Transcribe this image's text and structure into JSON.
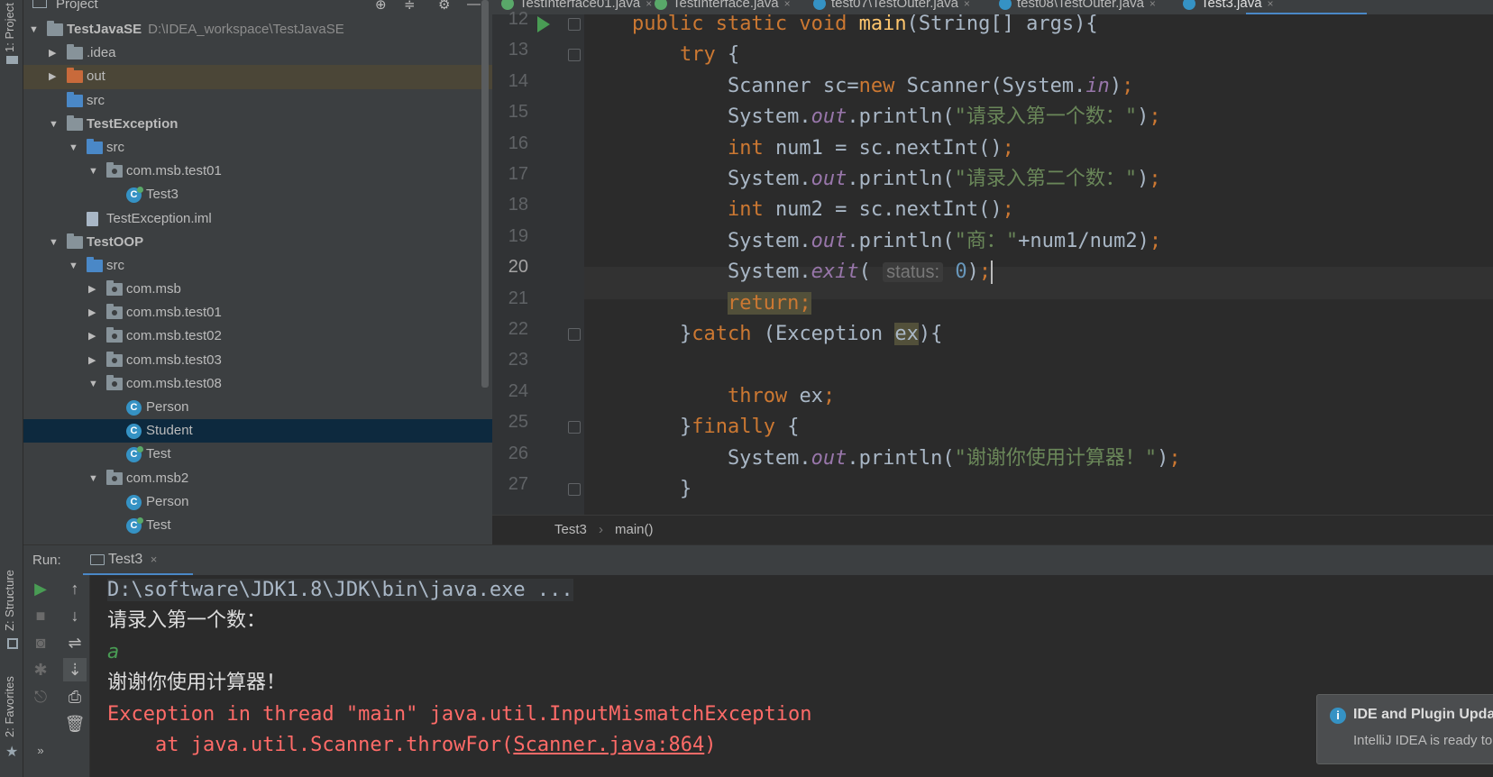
{
  "left_strip": {
    "project_label": "1: Project",
    "structure_label": "Z: Structure",
    "favorites_label": "2: Favorites"
  },
  "project_panel": {
    "title": "Project",
    "tree": [
      {
        "label": "TestJavaSE",
        "path": "D:\\IDEA_workspace\\TestJavaSE",
        "indent": 0,
        "arrow": "▼",
        "icon": "folder",
        "bold": true
      },
      {
        "label": ".idea",
        "indent": 1,
        "arrow": "▶",
        "icon": "folder"
      },
      {
        "label": "out",
        "indent": 1,
        "arrow": "▶",
        "icon": "folder-orange",
        "highlight": true
      },
      {
        "label": "src",
        "indent": 1,
        "arrow": "",
        "icon": "folder-blue"
      },
      {
        "label": "TestException",
        "indent": 1,
        "arrow": "▼",
        "icon": "folder",
        "bold": true
      },
      {
        "label": "src",
        "indent": 2,
        "arrow": "▼",
        "icon": "folder-blue"
      },
      {
        "label": "com.msb.test01",
        "indent": 3,
        "arrow": "▼",
        "icon": "package"
      },
      {
        "label": "Test3",
        "indent": 4,
        "arrow": "",
        "icon": "class-run"
      },
      {
        "label": "TestException.iml",
        "indent": 2,
        "arrow": "",
        "icon": "file"
      },
      {
        "label": "TestOOP",
        "indent": 1,
        "arrow": "▼",
        "icon": "folder",
        "bold": true
      },
      {
        "label": "src",
        "indent": 2,
        "arrow": "▼",
        "icon": "folder-blue"
      },
      {
        "label": "com.msb",
        "indent": 3,
        "arrow": "▶",
        "icon": "package"
      },
      {
        "label": "com.msb.test01",
        "indent": 3,
        "arrow": "▶",
        "icon": "package"
      },
      {
        "label": "com.msb.test02",
        "indent": 3,
        "arrow": "▶",
        "icon": "package"
      },
      {
        "label": "com.msb.test03",
        "indent": 3,
        "arrow": "▶",
        "icon": "package"
      },
      {
        "label": "com.msb.test08",
        "indent": 3,
        "arrow": "▼",
        "icon": "package"
      },
      {
        "label": "Person",
        "indent": 4,
        "arrow": "",
        "icon": "class"
      },
      {
        "label": "Student",
        "indent": 4,
        "arrow": "",
        "icon": "class",
        "selected": true
      },
      {
        "label": "Test",
        "indent": 4,
        "arrow": "",
        "icon": "class-run"
      },
      {
        "label": "com.msb2",
        "indent": 3,
        "arrow": "▼",
        "icon": "package"
      },
      {
        "label": "Person",
        "indent": 4,
        "arrow": "",
        "icon": "class"
      },
      {
        "label": "Test",
        "indent": 4,
        "arrow": "",
        "icon": "class-run"
      }
    ]
  },
  "tabs": [
    {
      "label": "TestInterface01.java",
      "icon": "interface",
      "close": "×"
    },
    {
      "label": "TestInterface.java",
      "icon": "interface",
      "close": "×"
    },
    {
      "label": "test07\\TestOuter.java",
      "icon": "class",
      "close": "×"
    },
    {
      "label": "test08\\TestOuter.java",
      "icon": "class",
      "close": "×"
    },
    {
      "label": "Test3.java",
      "icon": "class",
      "close": "×",
      "active": true
    }
  ],
  "editor": {
    "line_numbers": [
      "12",
      "13",
      "14",
      "15",
      "16",
      "17",
      "18",
      "19",
      "20",
      "21",
      "22",
      "23",
      "24",
      "25",
      "26",
      "27"
    ],
    "current_line": "20",
    "code": [
      [
        {
          "t": "    "
        },
        {
          "t": "public static void ",
          "c": "kw"
        },
        {
          "t": "main",
          "c": "fn"
        },
        {
          "t": "(String[] args){"
        }
      ],
      [
        {
          "t": "        "
        },
        {
          "t": "try ",
          "c": "kw"
        },
        {
          "t": "{"
        }
      ],
      [
        {
          "t": "            Scanner sc="
        },
        {
          "t": "new ",
          "c": "kw"
        },
        {
          "t": "Scanner(System."
        },
        {
          "t": "in",
          "c": "fld"
        },
        {
          "t": ")"
        },
        {
          "t": ";",
          "c": "kw"
        }
      ],
      [
        {
          "t": "            System."
        },
        {
          "t": "out",
          "c": "fld"
        },
        {
          "t": ".println("
        },
        {
          "t": "\"请录入第一个数：\"",
          "c": "str"
        },
        {
          "t": ")"
        },
        {
          "t": ";",
          "c": "kw"
        }
      ],
      [
        {
          "t": "            "
        },
        {
          "t": "int ",
          "c": "kw"
        },
        {
          "t": "num1 = sc.nextInt()"
        },
        {
          "t": ";",
          "c": "kw"
        }
      ],
      [
        {
          "t": "            System."
        },
        {
          "t": "out",
          "c": "fld"
        },
        {
          "t": ".println("
        },
        {
          "t": "\"请录入第二个数：\"",
          "c": "str"
        },
        {
          "t": ")"
        },
        {
          "t": ";",
          "c": "kw"
        }
      ],
      [
        {
          "t": "            "
        },
        {
          "t": "int ",
          "c": "kw"
        },
        {
          "t": "num2 = sc.nextInt()"
        },
        {
          "t": ";",
          "c": "kw"
        }
      ],
      [
        {
          "t": "            System."
        },
        {
          "t": "out",
          "c": "fld"
        },
        {
          "t": ".println("
        },
        {
          "t": "\"商：\"",
          "c": "str"
        },
        {
          "t": "+num1/num2)"
        },
        {
          "t": ";",
          "c": "kw"
        }
      ],
      [
        {
          "t": "            System."
        },
        {
          "t": "exit",
          "c": "fld"
        },
        {
          "t": "( "
        },
        {
          "t": "status:",
          "c": "hint"
        },
        {
          "t": " "
        },
        {
          "t": "0",
          "c": "num"
        },
        {
          "t": ")"
        },
        {
          "t": ";",
          "c": "kw"
        },
        {
          "t": "",
          "c": "caret"
        }
      ],
      [
        {
          "t": "            "
        },
        {
          "t": "return;",
          "c": "kw hlbox"
        }
      ],
      [
        {
          "t": "        }"
        },
        {
          "t": "catch ",
          "c": "kw"
        },
        {
          "t": "(Exception "
        },
        {
          "t": "ex",
          "c": "hlbox"
        },
        {
          "t": "){"
        }
      ],
      [
        {
          "t": ""
        }
      ],
      [
        {
          "t": "            "
        },
        {
          "t": "throw ",
          "c": "kw"
        },
        {
          "t": "ex"
        },
        {
          "t": ";",
          "c": "kw"
        }
      ],
      [
        {
          "t": "        }"
        },
        {
          "t": "finally ",
          "c": "kw"
        },
        {
          "t": "{"
        }
      ],
      [
        {
          "t": "            System."
        },
        {
          "t": "out",
          "c": "fld"
        },
        {
          "t": ".println("
        },
        {
          "t": "\"谢谢你使用计算器！\"",
          "c": "str"
        },
        {
          "t": ")"
        },
        {
          "t": ";",
          "c": "kw"
        }
      ],
      [
        {
          "t": "        }"
        }
      ]
    ],
    "breadcrumb": [
      "Test3",
      "main()"
    ]
  },
  "run_panel": {
    "label": "Run:",
    "tab": "Test3",
    "tab_close": "×",
    "console": [
      {
        "text": "D:\\software\\JDK1.8\\JDK\\bin\\java.exe ...",
        "kind": "cmd"
      },
      {
        "text": "请录入第一个数：",
        "kind": "out"
      },
      {
        "text": "a",
        "kind": "in"
      },
      {
        "text": "谢谢你使用计算器！",
        "kind": "out"
      },
      {
        "text": "Exception in thread \"main\" java.util.InputMismatchException",
        "kind": "err"
      },
      {
        "text": "    at java.util.Scanner.throwFor(",
        "kind": "err",
        "link": "Scanner.java:864",
        "suffix": ")"
      }
    ]
  },
  "notification": {
    "title": "IDE and Plugin Updates",
    "body": "IntelliJ IDEA is ready to update."
  },
  "colors": {
    "keyword": "#cc7832",
    "string": "#6a8759",
    "field": "#9876aa",
    "number": "#6897bb",
    "method": "#ffc66d",
    "error": "#ff6b68",
    "selection": "#0d293e",
    "accent": "#4a88c7"
  }
}
